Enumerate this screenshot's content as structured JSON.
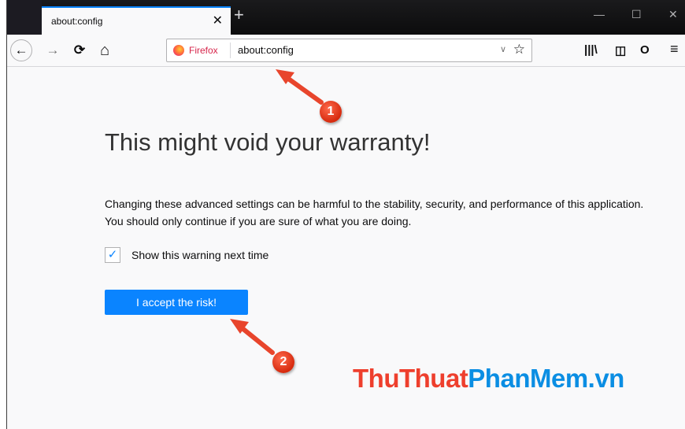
{
  "tab": {
    "title": "about:config",
    "close": "✕",
    "new_tab": "+"
  },
  "window_controls": {
    "minimize": "—",
    "maximize": "☐",
    "close": "✕"
  },
  "toolbar": {
    "back": "←",
    "forward": "→",
    "reload": "⟳",
    "home": "⌂",
    "identity_label": "Firefox",
    "url": "about:config",
    "dropdown": "∨",
    "bookmark_star": "☆",
    "library": "|||\\",
    "sidebar": "◫",
    "extension": "O",
    "menu": "≡"
  },
  "page": {
    "title": "This might void your warranty!",
    "body": "Changing these advanced settings can be harmful to the stability, security, and performance of this application. You should only continue if you are sure of what you are doing.",
    "checkbox_label": "Show this warning next time",
    "checkbox_checked": true,
    "checkmark": "✓",
    "accept_button": "I accept the risk!"
  },
  "annotations": {
    "badge_1": "1",
    "badge_2": "2"
  },
  "watermark": {
    "part1": "ThuThuat",
    "part2": "PhanMem.vn"
  },
  "colors": {
    "accent": "#0a84ff",
    "annotation": "#e8452c",
    "watermark_red": "#ee3f2d",
    "watermark_blue": "#0b8ee3"
  }
}
